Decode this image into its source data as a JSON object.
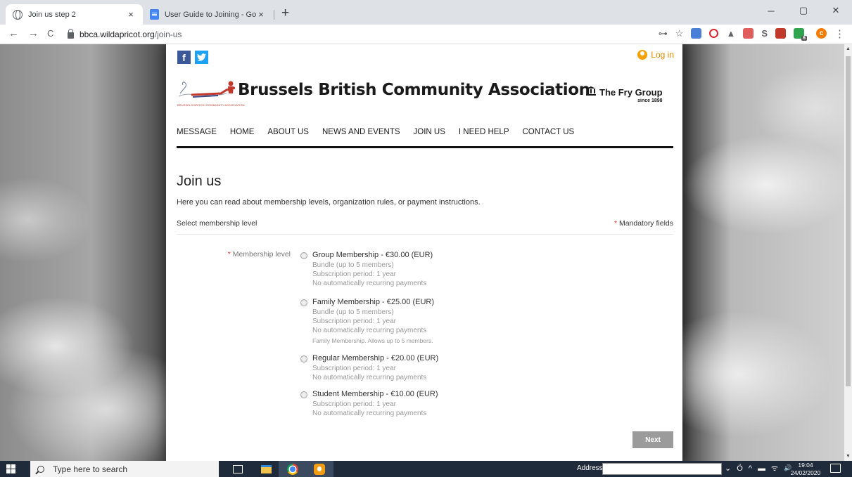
{
  "browser": {
    "tabs": [
      {
        "title": "Join us step 2",
        "active": true,
        "icon": "globe-icon"
      },
      {
        "title": "User Guide to Joining - Google D",
        "active": false,
        "icon": "google-docs-icon"
      }
    ],
    "close_glyph": "×",
    "new_tab_glyph": "+",
    "window_controls": {
      "minimize": "─",
      "restore": "▢",
      "close": "✕"
    },
    "nav": {
      "back": "←",
      "forward": "→",
      "reload": "C"
    },
    "url_host": "bbca.wildapricot.org",
    "url_path": "/join-us",
    "toolbar_icons": {
      "key": "⊶",
      "star": "☆",
      "menu": "⋮"
    },
    "profile_initial": "c",
    "extension_badge": "6",
    "extension_glyphs": [
      "O",
      "▲",
      "▣",
      "S",
      "⅄"
    ]
  },
  "site": {
    "login_label": "Log in",
    "social": {
      "facebook": "f",
      "twitter": "t"
    },
    "brand_name": "Brussels British Community Association",
    "logo_caption": "BRUSSELS BRITISH COMMUNITY ASSOCIATION",
    "sponsor_icon": "Ᏸ",
    "sponsor_name": "The Fry Group",
    "sponsor_since": "since 1898",
    "nav": [
      "MESSAGE",
      "HOME",
      "ABOUT US",
      "NEWS AND EVENTS",
      "JOIN US",
      "I NEED HELP",
      "CONTACT US"
    ]
  },
  "form": {
    "title": "Join us",
    "intro": "Here you can read about membership levels, organization rules, or payment instructions.",
    "section_label": "Select membership level",
    "mandatory_asterisk": "*",
    "mandatory_label": "Mandatory fields",
    "field_label": "Membership level",
    "options": [
      {
        "title": "Group Membership - €30.00 (EUR)",
        "lines": [
          "Bundle (up to 5 members)",
          "Subscription period: 1 year",
          "No automatically recurring payments"
        ],
        "note": ""
      },
      {
        "title": "Family Membership - €25.00 (EUR)",
        "lines": [
          "Bundle (up to 5 members)",
          "Subscription period: 1 year",
          "No automatically recurring payments"
        ],
        "note": "Family Membership. Allows up to 5 members."
      },
      {
        "title": "Regular Membership - €20.00 (EUR)",
        "lines": [
          "Subscription period: 1 year",
          "No automatically recurring payments"
        ],
        "note": ""
      },
      {
        "title": "Student Membership - €10.00 (EUR)",
        "lines": [
          "Subscription period: 1 year",
          "No automatically recurring payments"
        ],
        "note": ""
      }
    ],
    "next_label": "Next"
  },
  "taskbar": {
    "search_placeholder": "Type here to search",
    "address_label": "Address",
    "tray_glyphs": [
      "⌄",
      "Ö",
      "^",
      "▬",
      "ᯤ",
      "🔊"
    ],
    "time": "19:04",
    "date": "24/02/2020"
  },
  "colors": {
    "brand_red": "#e0312e",
    "facebook": "#3b5998",
    "twitter": "#1da1f2",
    "login_orange": "#f4a100",
    "button_gray": "#9b9b9b"
  }
}
